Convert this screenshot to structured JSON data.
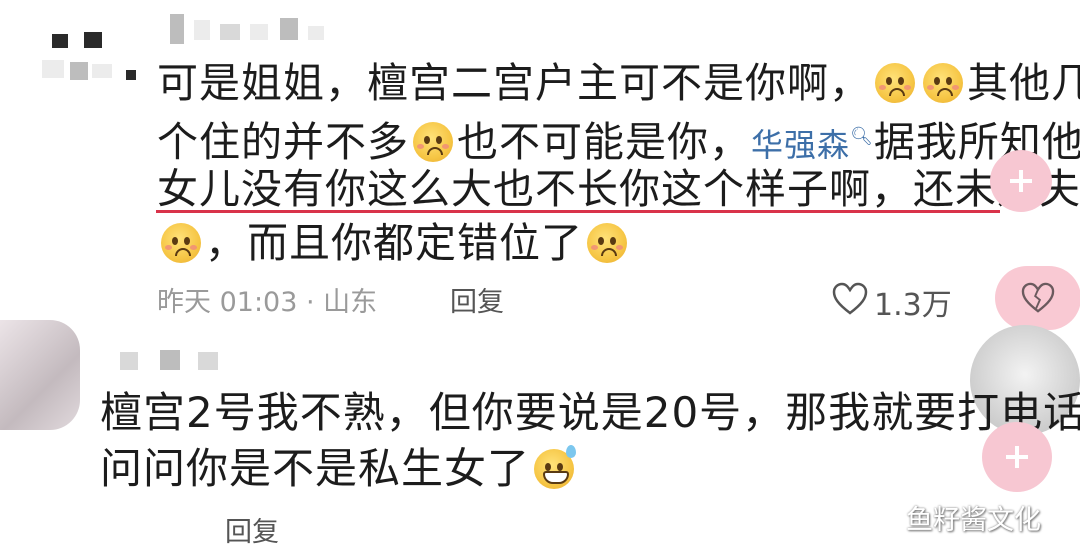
{
  "comment1": {
    "line1_a": "可是姐姐，檀宫二宫户主可不是你啊，",
    "line1_b": "其他几",
    "line2_a": "个住的并不多",
    "line2_b": "也不可能是你，",
    "link_name": "华强森",
    "line2_c": "据我所知他",
    "line3": "女儿没有你这么大也不长你这个样子啊，还未婚夫",
    "line4": "，而且你都定错位了",
    "meta": "昨天 01:03 · 山东",
    "reply_label": "回复",
    "likes": "1.3万",
    "emoji_icons": [
      "pleading-face-icon",
      "pleading-face-icon",
      "pleading-face-icon",
      "pleading-face-icon",
      "pleading-face-icon"
    ]
  },
  "comment2": {
    "line1": "檀宫2号我不熟，但你要说是20号，那我就要打电话",
    "line2": "问问你是不是私生女了",
    "reply_label": "回复",
    "emoji_icons": [
      "grinning-sweat-face-icon"
    ]
  },
  "watermark": "鱼籽酱文化",
  "colors": {
    "link": "#3d6fa8",
    "underline": "#d9334a",
    "pink_button": "#f7c7d2",
    "meta_text": "#9a9a9a"
  }
}
